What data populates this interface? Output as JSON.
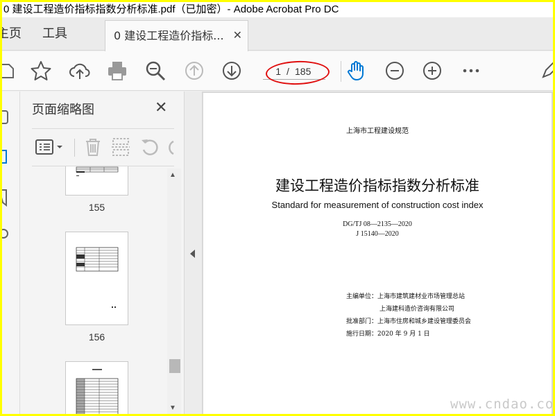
{
  "window": {
    "title": "0 建设工程造价指标指数分析标准.pdf（已加密）- Adobe Acrobat Pro DC"
  },
  "nav": {
    "home_label": "主页",
    "tools_label": "工具"
  },
  "doc_tab": {
    "label": "0 建设工程造价指标..."
  },
  "toolbar": {
    "current_page": "1",
    "page_separator": "/",
    "total_pages": "185",
    "icons": [
      "save-icon",
      "bookmark-star-icon",
      "upload-icon",
      "print-icon",
      "zoom-search-icon",
      "previous-page-icon",
      "next-page-icon",
      "hand-tool-icon",
      "zoom-out-icon",
      "zoom-in-icon",
      "more-icon",
      "pen-icon"
    ],
    "accent_color": "#0078d4",
    "highlight_color": "#e01010"
  },
  "panel": {
    "title": "页面缩略图",
    "thumbnails": [
      {
        "page": "155"
      },
      {
        "page": "156"
      },
      {
        "page": ""
      }
    ]
  },
  "document": {
    "series": "上海市工程建设规范",
    "title_cn": "建设工程造价指标指数分析标准",
    "title_en": "Standard for measurement of construction cost index",
    "code1": "DG/TJ 08—2135—2020",
    "code2": "J 15140—2020",
    "info": [
      "主编单位：上海市建筑建材业市场管理总站",
      "上海建科造价咨询有限公司",
      "批准部门：上海市住房和城乡建设管理委员会",
      "施行日期：2020 年 9 月 1 日"
    ]
  },
  "watermark": "www.cndao.com"
}
